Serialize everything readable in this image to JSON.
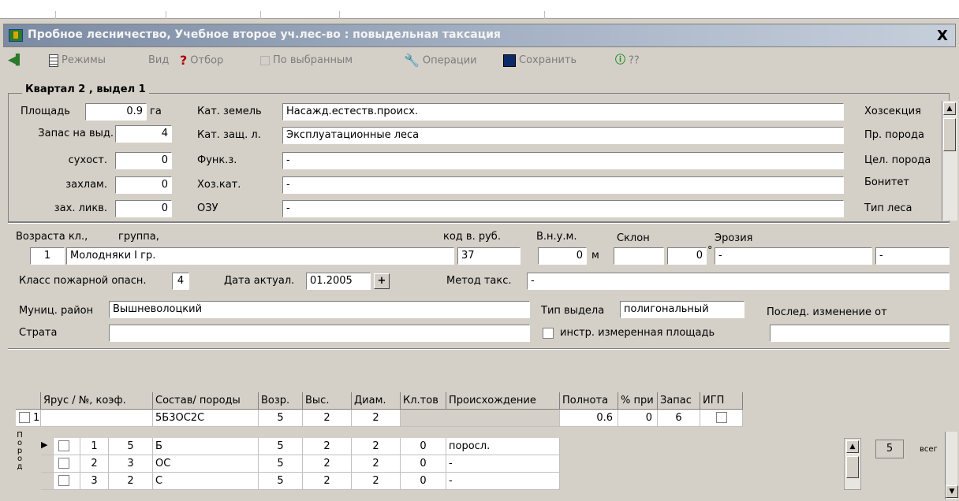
{
  "window": {
    "title": "Пробное лесничество, Учебное второе уч.лес-во : повыдельная таксация",
    "close": "X"
  },
  "toolbar": {
    "modes": "Режимы",
    "view": "Вид",
    "filter": "Отбор",
    "selected": "По выбранным",
    "operations": "Операции",
    "save": "Сохранить",
    "help": "??"
  },
  "header": {
    "group_title": "Квартал 2 , выдел 1"
  },
  "fields": {
    "area_label": "Площадь",
    "area_value": "0.9",
    "area_unit": "га",
    "stock_label": "Запас на выд.",
    "stock_value": "4",
    "dry_label": "сухост.",
    "dry_value": "0",
    "litter_label": "захлам.",
    "litter_value": "0",
    "litter_liq_label": "зах. ликв.",
    "litter_liq_value": "0",
    "land_cat_label": "Кат. земель",
    "land_cat_value": "Насажд.естеств.происх.",
    "prot_cat_label": "Кат. защ. л.",
    "prot_cat_value": "Эксплуатационные леса",
    "func_label": "Функ.з.",
    "func_value": "-",
    "eco_cat_label": "Хоз.кат.",
    "eco_cat_value": "-",
    "ozu_label": "ОЗУ",
    "ozu_value": "-",
    "right_labels": [
      "Хозсекция",
      "Пр. порода",
      "Цел. порода",
      "Бонитет",
      "Тип леса"
    ]
  },
  "section2": {
    "age_label": "Возраста кл.,",
    "group_label": "группа,",
    "code_label": "код в. руб.",
    "alt_label": "В.н.у.м.",
    "slope_label": "Склон",
    "erosion_label": "Эрозия",
    "age_value": "1",
    "group_value": "Молодняки I гр.",
    "code_value": "37",
    "alt_value": "0",
    "alt_unit": "м",
    "slope_value": "",
    "slope_deg": "0",
    "deg_symbol": "°",
    "erosion_value": "-",
    "erosion_value2": "-",
    "fire_label": "Класс пожарной опасн.",
    "fire_value": "4",
    "date_label": "Дата актуал.",
    "date_value": "01.2005",
    "date_btn": "+",
    "method_label": "Метод такс.",
    "method_value": "-",
    "munic_label": "Муниц. район",
    "munic_value": "Вышневолоцкий",
    "strata_label": "Страта",
    "strata_value": "",
    "type_label": "Тип выдела",
    "type_value": "полигональный",
    "last_change_label": "Послед. изменение от",
    "last_change_value": "",
    "instr_label": "инстр. измеренная площадь"
  },
  "grid": {
    "headers": [
      "Ярус / №, коэф.",
      "Состав/ породы",
      "Возр.",
      "Выс.",
      "Диам.",
      "Кл.тов",
      "Происхождение",
      "Полнота",
      "% при",
      "Запас",
      "ИГП"
    ],
    "tier_row": {
      "tier": "1",
      "composition": "5Б3ОС2С",
      "age": "5",
      "height": "2",
      "diam": "2",
      "density": "0.6",
      "percent": "0",
      "stock": "6"
    },
    "side_label": [
      "П",
      "о",
      "р",
      "о",
      "д"
    ],
    "species_rows": [
      {
        "n": "1",
        "k": "5",
        "sp": "Б",
        "age": "5",
        "h": "2",
        "d": "2",
        "kl": "0",
        "orig": "поросл."
      },
      {
        "n": "2",
        "k": "3",
        "sp": "ОС",
        "age": "5",
        "h": "2",
        "d": "2",
        "kl": "0",
        "orig": "-"
      },
      {
        "n": "3",
        "k": "2",
        "sp": "С",
        "age": "5",
        "h": "2",
        "d": "2",
        "kl": "0",
        "orig": "-"
      }
    ],
    "count_value": "5",
    "count_label": "всег"
  }
}
